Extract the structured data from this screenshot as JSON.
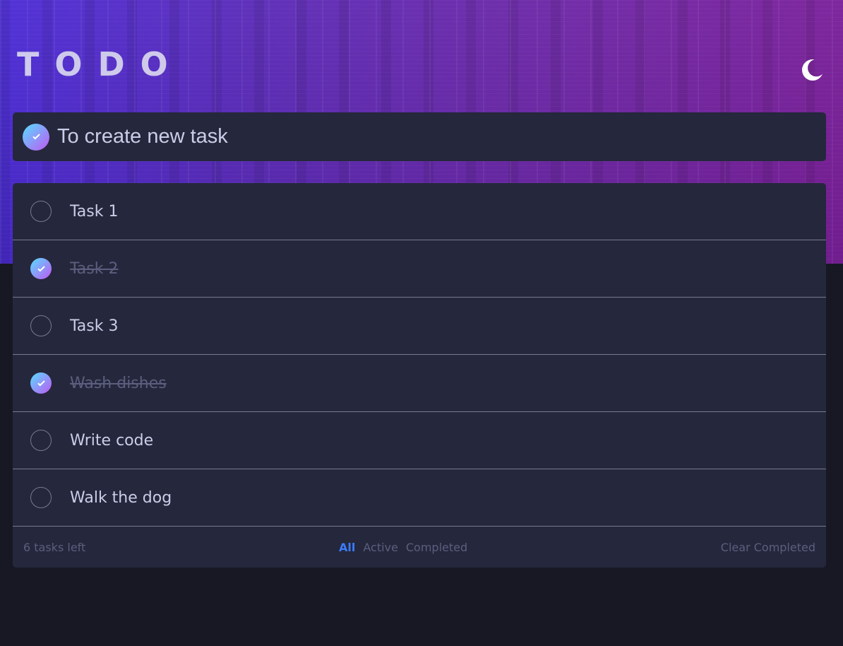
{
  "app": {
    "title": "TODO"
  },
  "theme_toggle": {
    "icon": "moon-icon"
  },
  "new_task": {
    "placeholder": "To create new task",
    "value": ""
  },
  "tasks": [
    {
      "label": "Task 1",
      "completed": false
    },
    {
      "label": "Task 2",
      "completed": true
    },
    {
      "label": "Task 3",
      "completed": false
    },
    {
      "label": "Wash dishes",
      "completed": true
    },
    {
      "label": "Write code",
      "completed": false
    },
    {
      "label": "Walk the dog",
      "completed": false
    }
  ],
  "footer": {
    "items_left": "6 tasks left",
    "filters": {
      "all": "All",
      "active": "Active",
      "completed": "Completed"
    },
    "selected_filter": "All",
    "clear_label": "Clear Completed"
  },
  "colors": {
    "accent": "#3a7cfd",
    "gradient_start": "#57ddff",
    "gradient_end": "#c058f3",
    "panel": "#25273c",
    "background": "#181824"
  }
}
